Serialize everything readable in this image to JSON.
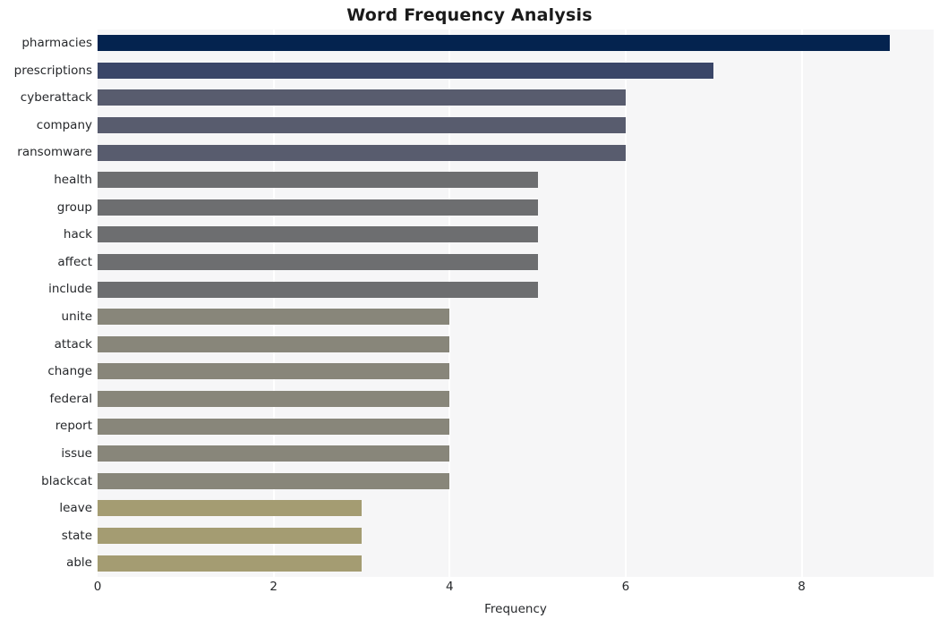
{
  "chart_data": {
    "type": "bar",
    "orientation": "horizontal",
    "title": "Word Frequency Analysis",
    "xlabel": "Frequency",
    "ylabel": "",
    "categories": [
      "pharmacies",
      "prescriptions",
      "cyberattack",
      "company",
      "ransomware",
      "health",
      "group",
      "hack",
      "affect",
      "include",
      "unite",
      "attack",
      "change",
      "federal",
      "report",
      "issue",
      "blackcat",
      "leave",
      "state",
      "able"
    ],
    "values": [
      9,
      7,
      6,
      6,
      6,
      5,
      5,
      5,
      5,
      5,
      4,
      4,
      4,
      4,
      4,
      4,
      4,
      3,
      3,
      3
    ],
    "bar_colors": [
      "#04234f",
      "#3a4668",
      "#585c6e",
      "#585c6e",
      "#585c6e",
      "#6d6e70",
      "#6d6e70",
      "#6d6e70",
      "#6d6e70",
      "#6d6e70",
      "#88867a",
      "#88867a",
      "#88867a",
      "#88867a",
      "#88867a",
      "#88867a",
      "#88867a",
      "#a49c72",
      "#a49c72",
      "#a49c72"
    ],
    "xlim": [
      0,
      9.5
    ],
    "xticks": [
      0,
      2,
      4,
      6,
      8
    ],
    "xtick_labels": [
      "0",
      "2",
      "4",
      "6",
      "8"
    ],
    "grid": "vertical-white",
    "plot_background": "#f6f6f7",
    "figure_background": "#ffffff",
    "legend": "none"
  }
}
